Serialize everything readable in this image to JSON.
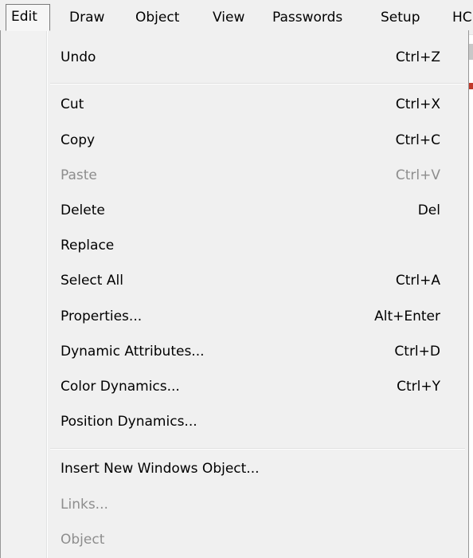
{
  "menubar": {
    "items": [
      {
        "label": "Edit",
        "active": true
      },
      {
        "label": "Draw"
      },
      {
        "label": "Object"
      },
      {
        "label": "View"
      },
      {
        "label": "Passwords"
      },
      {
        "label": "Setup"
      },
      {
        "label": "HC"
      }
    ]
  },
  "edit_menu": {
    "items": [
      {
        "label": "Undo",
        "shortcut": "Ctrl+Z",
        "enabled": true
      },
      {
        "label": "Cut",
        "shortcut": "Ctrl+X",
        "enabled": true
      },
      {
        "label": "Copy",
        "shortcut": "Ctrl+C",
        "enabled": true
      },
      {
        "label": "Paste",
        "shortcut": "Ctrl+V",
        "enabled": false
      },
      {
        "label": "Delete",
        "shortcut": "Del",
        "enabled": true
      },
      {
        "label": "Replace",
        "shortcut": "",
        "enabled": true
      },
      {
        "label": "Select All",
        "shortcut": "Ctrl+A",
        "enabled": true
      },
      {
        "label": "Properties...",
        "shortcut": "Alt+Enter",
        "enabled": true
      },
      {
        "label": "Dynamic Attributes...",
        "shortcut": "Ctrl+D",
        "enabled": true
      },
      {
        "label": "Color Dynamics...",
        "shortcut": "Ctrl+Y",
        "enabled": true
      },
      {
        "label": "Position Dynamics...",
        "shortcut": "",
        "enabled": true
      },
      {
        "label": "Insert New Windows Object...",
        "shortcut": "",
        "enabled": true
      },
      {
        "label": "Links...",
        "shortcut": "",
        "enabled": false
      },
      {
        "label": "Object",
        "shortcut": "",
        "enabled": false
      }
    ]
  }
}
